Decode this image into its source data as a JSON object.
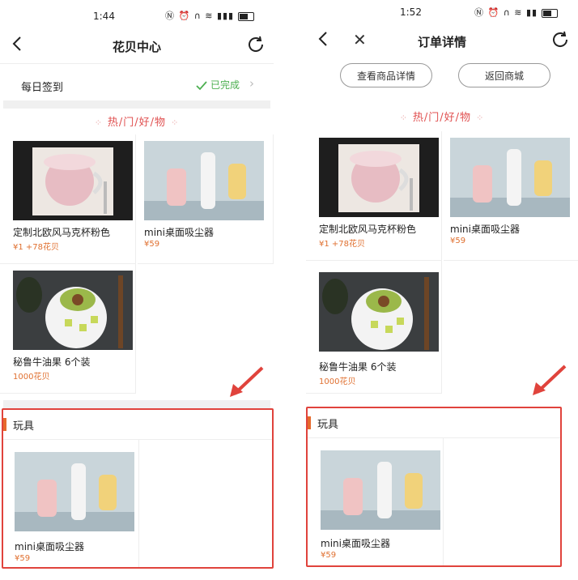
{
  "left": {
    "status_time": "1:44",
    "title": "花贝中心",
    "signin_label": "每日签到",
    "signin_status": "已完成",
    "hot_title": "热/门/好/物",
    "products": [
      {
        "name": "定制北欧风马克杯粉色",
        "price": "¥1 +78花贝"
      },
      {
        "name": "mini桌面吸尘器",
        "price": "¥59"
      },
      {
        "name": "秘鲁牛油果 6个装",
        "price": "1000花贝"
      }
    ],
    "section_title": "玩具",
    "section_products": [
      {
        "name": "mini桌面吸尘器",
        "price": "¥59"
      }
    ]
  },
  "right": {
    "status_time": "1:52",
    "title": "订单详情",
    "btn_view": "查看商品详情",
    "btn_back": "返回商城",
    "hot_title": "热/门/好/物",
    "products": [
      {
        "name": "定制北欧风马克杯粉色",
        "price": "¥1 +78花贝"
      },
      {
        "name": "mini桌面吸尘器",
        "price": "¥59"
      },
      {
        "name": "秘鲁牛油果 6个装",
        "price": "1000花贝"
      }
    ],
    "section_title": "玩具",
    "section_products": [
      {
        "name": "mini桌面吸尘器",
        "price": "¥59"
      }
    ]
  },
  "colors": {
    "accent": "#e0433c",
    "price": "#e07030",
    "done": "#4caf50"
  },
  "icons": [
    "back-arrow-icon",
    "close-icon",
    "refresh-icon",
    "check-icon",
    "chevron-right-icon"
  ]
}
